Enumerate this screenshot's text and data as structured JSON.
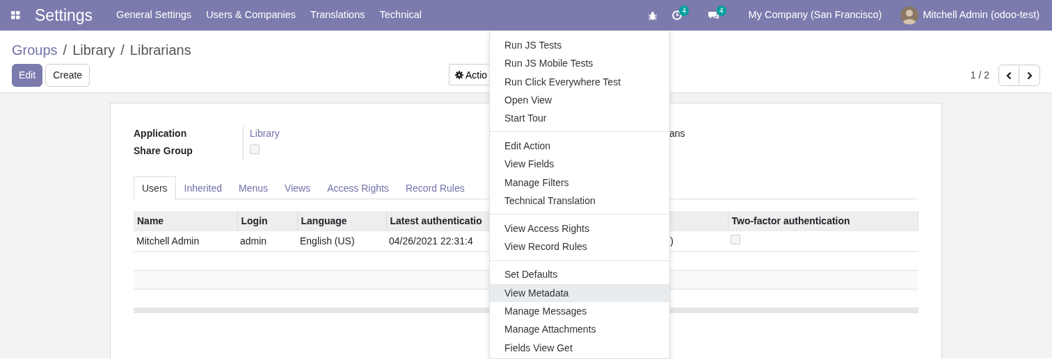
{
  "app": {
    "title": "Settings"
  },
  "nav": [
    "General Settings",
    "Users & Companies",
    "Translations",
    "Technical"
  ],
  "systray": {
    "activity_count": "4",
    "message_count": "4",
    "company": "My Company (San Francisco)",
    "user": "Mitchell Admin (odoo-test)"
  },
  "breadcrumb": [
    {
      "label": "Groups",
      "link": true
    },
    {
      "separator": "/",
      "label": "Library",
      "link": false
    },
    {
      "separator": "/",
      "label": "Librarians",
      "link": false
    }
  ],
  "buttons": [
    {
      "label": "Edit",
      "primary": true
    },
    {
      "label": "Create",
      "primary": false
    }
  ],
  "action_button": "Actio",
  "pager": "1 / 2",
  "form": {
    "fields": [
      {
        "label": "Application",
        "kind": "link",
        "value": "Library"
      },
      {
        "label": "Share Group",
        "kind": "checkbox",
        "checked": false
      }
    ],
    "name_fragment": "ans"
  },
  "tabs": [
    {
      "label": "Users",
      "selected": true
    },
    {
      "label": "Inherited",
      "selected": false
    },
    {
      "label": "Menus",
      "selected": false
    },
    {
      "label": "Views",
      "selected": false
    },
    {
      "label": "Access Rights",
      "selected": false
    },
    {
      "label": "Record Rules",
      "selected": false
    }
  ],
  "table": {
    "columns": [
      {
        "label": "Name"
      },
      {
        "label": "Login"
      },
      {
        "label": "Language"
      },
      {
        "label": "Latest authenticatio"
      },
      {
        "label": "Two-factor authentication"
      }
    ],
    "rows": [
      {
        "cells": [
          {
            "kind": "text",
            "text": "Mitchell Admin"
          },
          {
            "kind": "text",
            "text": "admin"
          },
          {
            "kind": "text",
            "text": "English (US)"
          },
          {
            "kind": "text",
            "text": "04/26/2021 22:31:4"
          },
          {
            "kind": "text",
            "text": ")"
          },
          {
            "kind": "checkbox",
            "checked": false
          }
        ]
      }
    ]
  },
  "menu": {
    "sections": [
      [
        {
          "label": "Run JS Tests",
          "selected": false
        },
        {
          "label": "Run JS Mobile Tests",
          "selected": false
        },
        {
          "label": "Run Click Everywhere Test",
          "selected": false
        },
        {
          "label": "Open View",
          "selected": false
        },
        {
          "label": "Start Tour",
          "selected": false
        }
      ],
      [
        {
          "label": "Edit Action",
          "selected": false
        },
        {
          "label": "View Fields",
          "selected": false
        },
        {
          "label": "Manage Filters",
          "selected": false
        },
        {
          "label": "Technical Translation",
          "selected": false
        }
      ],
      [
        {
          "label": "View Access Rights",
          "selected": false
        },
        {
          "label": "View Record Rules",
          "selected": false
        }
      ],
      [
        {
          "label": "Set Defaults",
          "selected": false
        },
        {
          "label": "View Metadata",
          "selected": true
        },
        {
          "label": "Manage Messages",
          "selected": false
        },
        {
          "label": "Manage Attachments",
          "selected": false
        },
        {
          "label": "Fields View Get",
          "selected": false
        }
      ]
    ]
  }
}
